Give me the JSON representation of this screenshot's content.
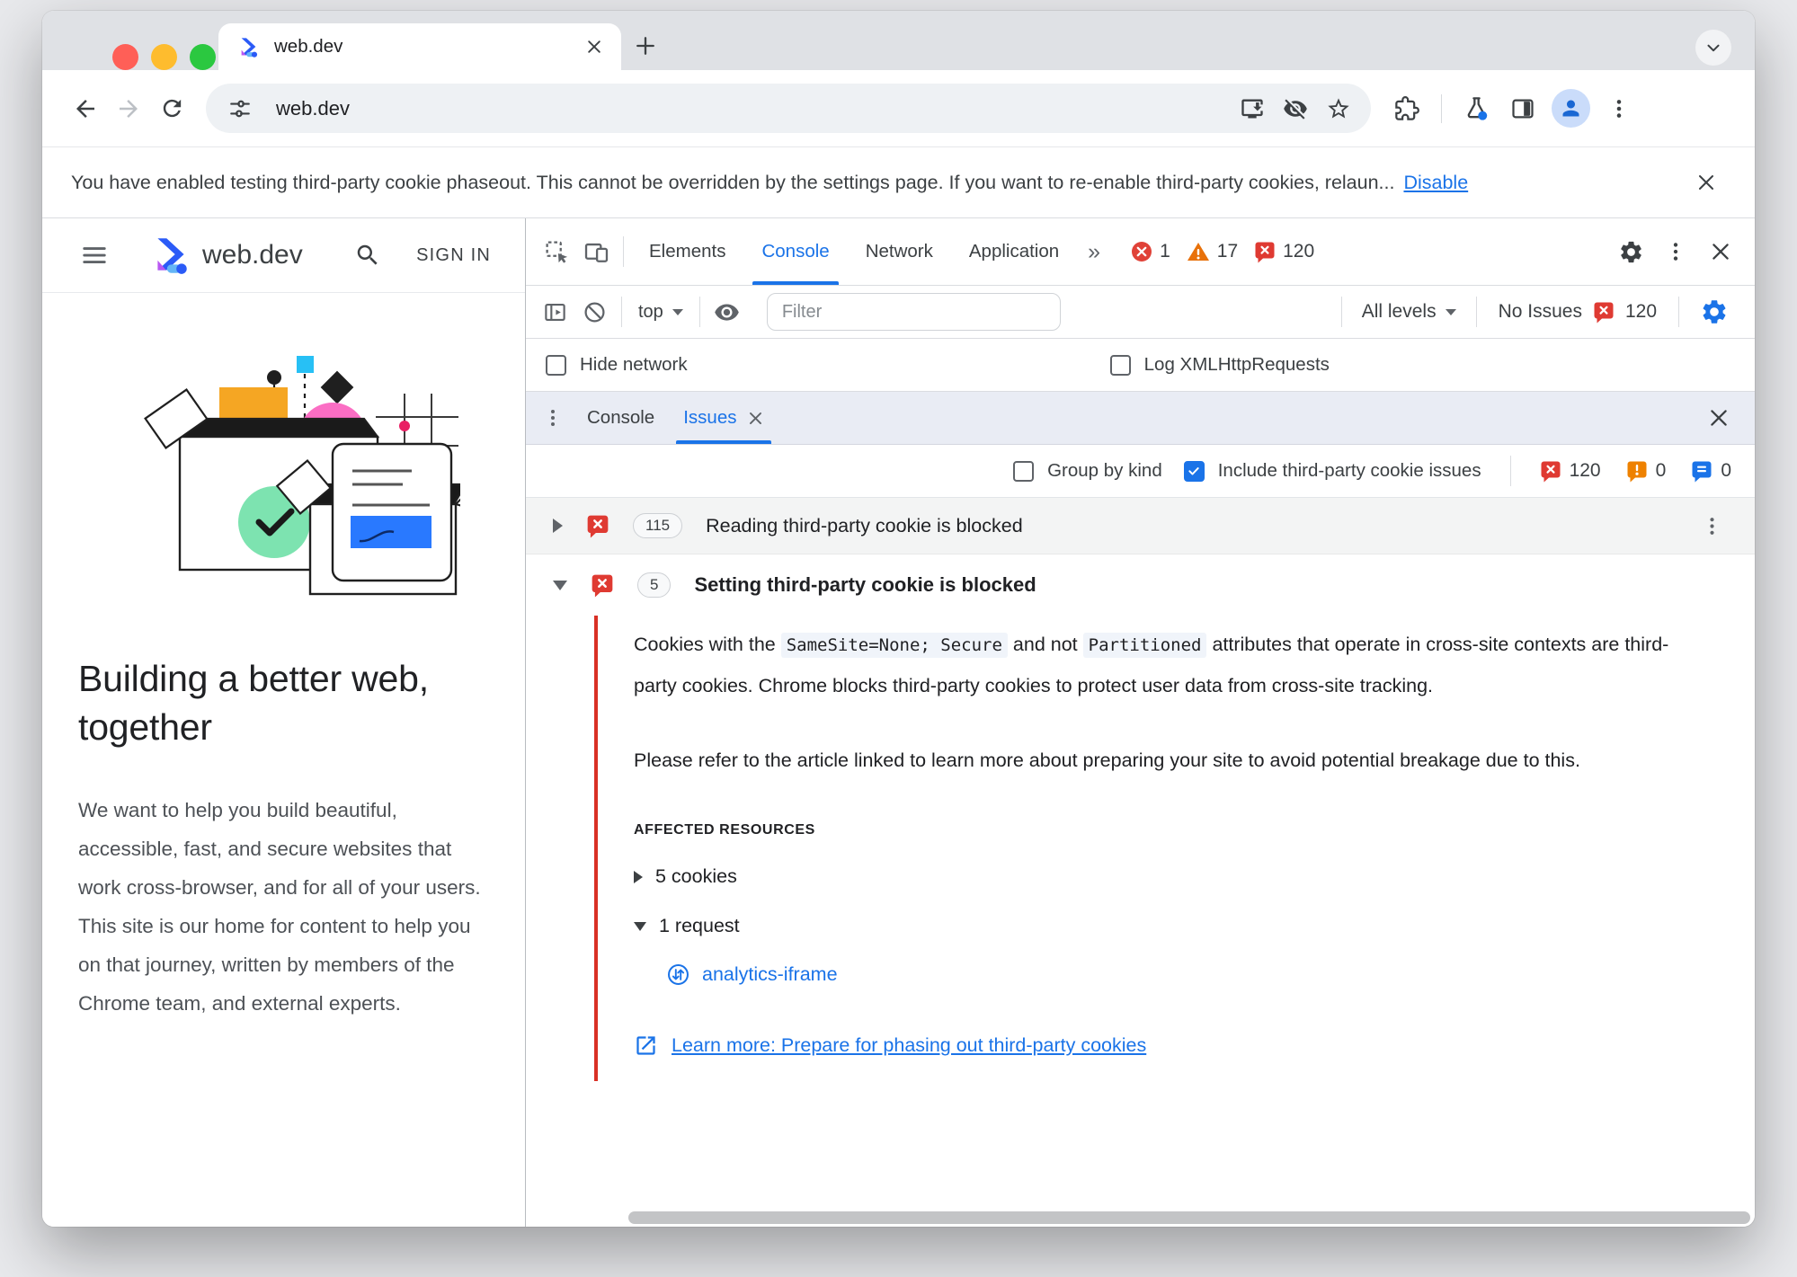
{
  "colors": {
    "accent_blue": "#1a73e8",
    "error_red": "#d93025",
    "warning_orange": "#e8710a",
    "link_blue": "#1a73e8"
  },
  "browser": {
    "tab_title": "web.dev",
    "url": "web.dev",
    "infobar": {
      "message": "You have enabled testing third-party cookie phaseout. This cannot be overridden by the settings page. If you want to re-enable third-party cookies, relaun...",
      "action": "Disable"
    }
  },
  "site": {
    "brand": "web.dev",
    "sign_in": "SIGN IN",
    "heading": "Building a better web, together",
    "paragraph": "We want to help you build beautiful, accessible, fast, and secure websites that work cross-browser, and for all of your users. This site is our home for content to help you on that journey, written by members of the Chrome team, and external experts."
  },
  "devtools": {
    "tabs": [
      "Elements",
      "Console",
      "Network",
      "Application"
    ],
    "more_tabs": "»",
    "badges": {
      "errors": "1",
      "warnings": "17",
      "issues": "120"
    },
    "console_toolbar": {
      "context": "top",
      "filter_placeholder": "Filter",
      "levels": "All levels",
      "issues_label": "No Issues",
      "issues_count": "120"
    },
    "settings_row": {
      "hide_network": "Hide network",
      "log_xhr": "Log XMLHttpRequests"
    },
    "drawer": {
      "console_tab": "Console",
      "issues_tab": "Issues"
    },
    "issues_toolbar": {
      "group_by_kind": "Group by kind",
      "include_third_party": "Include third-party cookie issues",
      "error_count": "120",
      "warning_count": "0",
      "info_count": "0"
    },
    "issues": [
      {
        "count": "115",
        "title": "Reading third-party cookie is blocked"
      },
      {
        "count": "5",
        "title": "Setting third-party cookie is blocked",
        "p1_pre": "Cookies with the ",
        "p1_code1": "SameSite=None; Secure",
        "p1_mid": " and not ",
        "p1_code2": "Partitioned",
        "p1_post": " attributes that operate in cross-site contexts are third-party cookies. Chrome blocks third-party cookies to protect user data from cross-site tracking.",
        "p2": "Please refer to the article linked to learn more about preparing your site to avoid potential breakage due to this.",
        "affected_header": "AFFECTED RESOURCES",
        "cookies_row": "5 cookies",
        "request_row": "1 request",
        "request_link": "analytics-iframe",
        "learn_more": "Learn more: Prepare for phasing out third-party cookies"
      }
    ]
  }
}
